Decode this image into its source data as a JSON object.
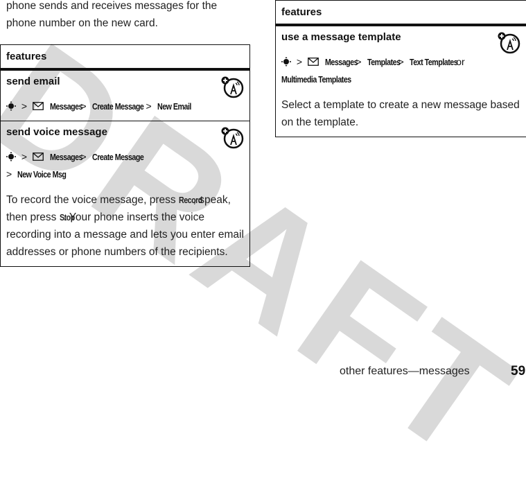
{
  "watermark": "DRAFT",
  "intro_text": "phone sends and receives messages for the phone number on the new card.",
  "left_table": {
    "header": "features",
    "rows": [
      {
        "title": "send email",
        "icon": "network-feature-icon",
        "path": {
          "nav_icon": "nav-key-icon",
          "sep": ">",
          "msg_icon": "envelope-icon",
          "steps": [
            "Messages",
            "Create Message",
            "New Email"
          ]
        }
      },
      {
        "title": "send voice message",
        "icon": "network-feature-icon",
        "path": {
          "nav_icon": "nav-key-icon",
          "sep": ">",
          "msg_icon": "envelope-icon",
          "steps": [
            "Messages",
            "Create Message",
            "New Voice Msg"
          ]
        },
        "description": {
          "p1": "To record the voice message, press ",
          "k1": "Record",
          "p2": ", speak, then press ",
          "k2": "Stop",
          "p3": ". Your phone inserts the voice recording into a message and lets you enter email addresses or phone numbers of the recipients."
        }
      }
    ]
  },
  "right_table": {
    "header": "features",
    "rows": [
      {
        "title": "use a message template",
        "icon": "network-feature-icon",
        "path": {
          "nav_icon": "nav-key-icon",
          "sep": ">",
          "msg_icon": "envelope-icon",
          "steps": [
            "Messages",
            "Templates",
            "Text Templates"
          ],
          "or": "or",
          "alt": "Multimedia Templates"
        },
        "description": "Select a template to create a new message based on the template."
      }
    ]
  },
  "footer": {
    "section": "other features—messages",
    "page": "59"
  }
}
